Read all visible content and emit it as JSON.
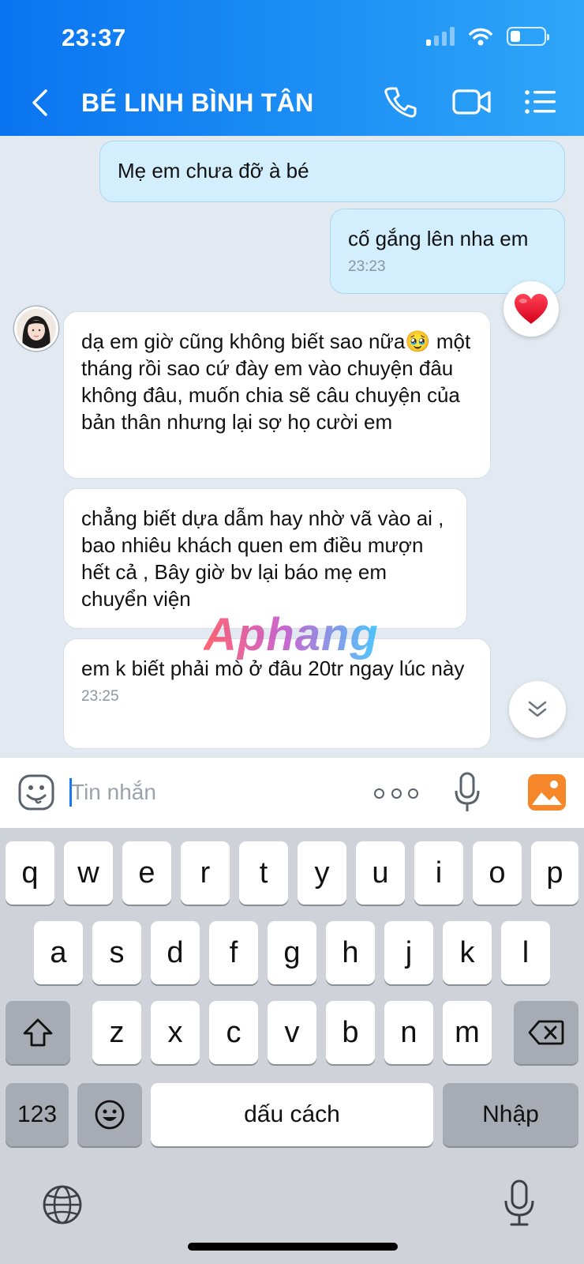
{
  "status_bar": {
    "time": "23:37"
  },
  "header": {
    "title": "BÉ LINH BÌNH TÂN",
    "icons": {
      "back": "chevron-left-icon",
      "call": "phone-icon",
      "video": "video-icon",
      "menu": "list-icon"
    }
  },
  "messages": [
    {
      "direction": "out",
      "text": "Mẹ em chưa đỡ à bé",
      "time": ""
    },
    {
      "direction": "out",
      "text": "cố gắng lên nha em",
      "time": "23:23",
      "reaction": "heart"
    },
    {
      "direction": "in",
      "text": "dạ em giờ cũng không biết sao nữa🥹 một tháng rồi sao cứ đày em vào chuyện đâu không đâu, muốn chia sẽ câu chuyện của bản thân nhưng lại sợ họ cười em",
      "time": ""
    },
    {
      "direction": "in",
      "text": "chẳng biết dựa dẫm hay nhờ vã vào ai , bao nhiêu khách quen em điều mượn hết cả , Bây giờ bv lại báo mẹ em chuyển viện",
      "time": ""
    },
    {
      "direction": "in",
      "text": "em k biết phải mò ở đâu 20tr ngay lúc này",
      "time": "23:25"
    }
  ],
  "watermark": "Aphang",
  "composer": {
    "placeholder": "Tin nhắn",
    "value": ""
  },
  "keyboard": {
    "row1": [
      "q",
      "w",
      "e",
      "r",
      "t",
      "y",
      "u",
      "i",
      "o",
      "p"
    ],
    "row2": [
      "a",
      "s",
      "d",
      "f",
      "g",
      "h",
      "j",
      "k",
      "l"
    ],
    "row3": [
      "z",
      "x",
      "c",
      "v",
      "b",
      "n",
      "m"
    ],
    "numbers_key": "123",
    "space_key": "dấu cách",
    "return_key": "Nhập"
  },
  "colors": {
    "header_blue": "#0a74f0",
    "out_bubble": "#d3eefc",
    "accent": "#1877f2",
    "heart": "#e8122b"
  }
}
